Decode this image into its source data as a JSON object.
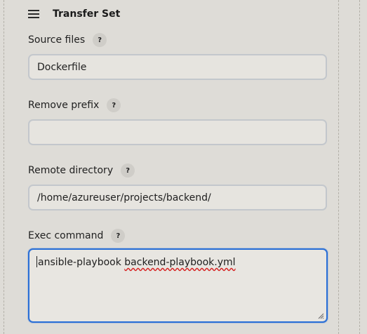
{
  "section": {
    "title": "Transfer Set"
  },
  "help_glyph": "?",
  "fields": {
    "source_files": {
      "label": "Source files",
      "value": "Dockerfile"
    },
    "remove_prefix": {
      "label": "Remove prefix",
      "value": ""
    },
    "remote_directory": {
      "label": "Remote directory",
      "value": "/home/azureuser/projects/backend/"
    },
    "exec_command": {
      "label": "Exec command",
      "word1": "ansible-playbook",
      "word2": "backend-playbook.yml"
    }
  },
  "colors": {
    "focus": "#2a6fd6",
    "background": "#dedcd7",
    "spellcheck": "#d62020"
  }
}
